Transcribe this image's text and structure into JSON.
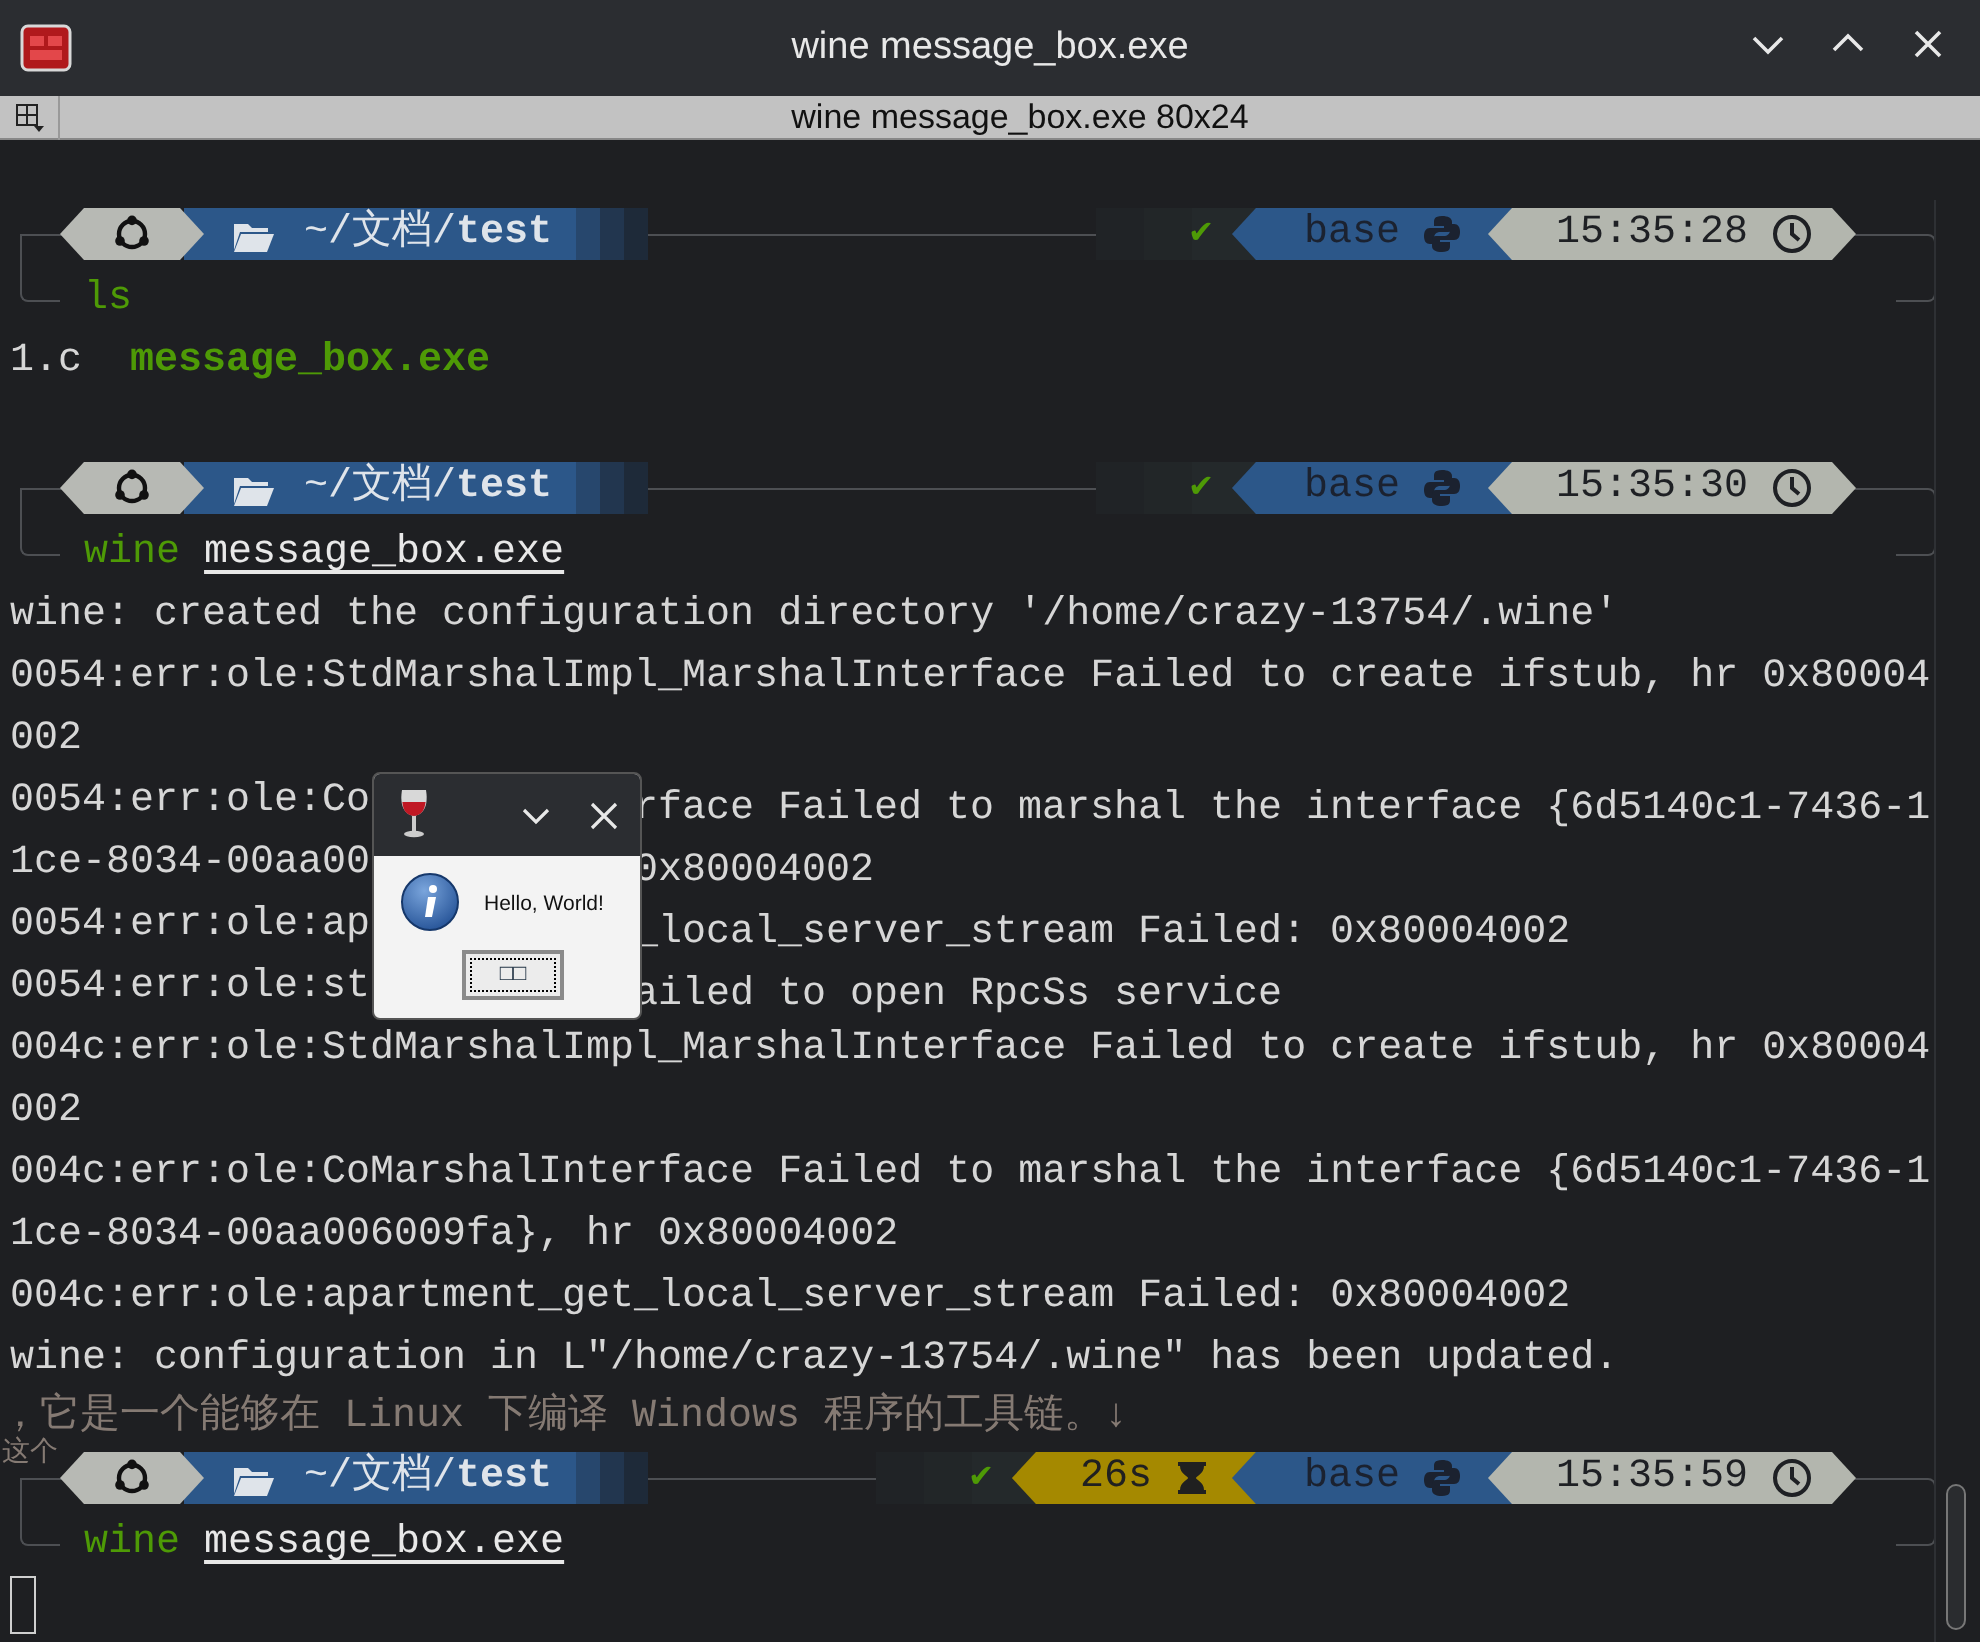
{
  "window": {
    "title": "wine message_box.exe"
  },
  "tab": {
    "title": "wine message_box.exe 80x24"
  },
  "terminal": {
    "lines": [
      {
        "kind": "prompt",
        "path": "~/文档/**test**",
        "status": "✔",
        "env": "base",
        "time": "15:35:28"
      },
      {
        "kind": "command",
        "program": "ls"
      },
      {
        "kind": "output",
        "segments": [
          {
            "text": "1.c",
            "kind": "plain"
          },
          {
            "text": "message_box.exe",
            "kind": "executable"
          }
        ]
      },
      {
        "kind": "blank"
      },
      {
        "kind": "prompt",
        "path": "~/文档/**test**",
        "status": "✔",
        "env": "base",
        "time": "15:35:30"
      },
      {
        "kind": "command",
        "program": "wine",
        "argument": "message_box.exe"
      },
      {
        "kind": "output",
        "segments": [
          {
            "text": "wine: created the configuration directory '/home/crazy-13754/.wine'",
            "kind": "plain"
          }
        ]
      },
      {
        "kind": "output",
        "segments": [
          {
            "text": "0054:err:ole:StdMarshalImpl_MarshalInterface Failed to create ifstub, hr 0x80004",
            "kind": "plain"
          }
        ]
      },
      {
        "kind": "output",
        "segments": [
          {
            "text": "002",
            "kind": "plain"
          }
        ]
      },
      {
        "kind": "output",
        "segments": [
          {
            "text": "0054:err:ole:Co",
            "kind": "plain"
          },
          {
            "text": "rface Failed to marshal the interface {6d5140c1-7436-1",
            "kind": "resumed"
          }
        ]
      },
      {
        "kind": "output",
        "segments": [
          {
            "text": "1ce-8034-00aa00",
            "kind": "plain"
          },
          {
            "text": "0x80004002",
            "kind": "resumed"
          }
        ]
      },
      {
        "kind": "output",
        "segments": [
          {
            "text": "0054:err:ole:ap",
            "kind": "plain"
          },
          {
            "text": "_local_server_stream Failed: 0x80004002",
            "kind": "resumed"
          }
        ]
      },
      {
        "kind": "output",
        "segments": [
          {
            "text": "0054:err:ole:st",
            "kind": "plain"
          },
          {
            "text": "ailed to open RpcSs service",
            "kind": "resumed"
          }
        ]
      },
      {
        "kind": "output",
        "segments": [
          {
            "text": "004c:err:ole:StdMarshalImpl_MarshalInterface Failed to create ifstub, hr 0x80004",
            "kind": "plain"
          }
        ]
      },
      {
        "kind": "output",
        "segments": [
          {
            "text": "002",
            "kind": "plain"
          }
        ]
      },
      {
        "kind": "output",
        "segments": [
          {
            "text": "004c:err:ole:CoMarshalInterface Failed to marshal the interface {6d5140c1-7436-1",
            "kind": "plain"
          }
        ]
      },
      {
        "kind": "output",
        "segments": [
          {
            "text": "1ce-8034-00aa006009fa}, hr 0x80004002",
            "kind": "plain"
          }
        ]
      },
      {
        "kind": "output",
        "segments": [
          {
            "text": "004c:err:ole:apartment_get_local_server_stream Failed: 0x80004002",
            "kind": "plain"
          }
        ]
      },
      {
        "kind": "output",
        "segments": [
          {
            "text": "wine: configuration in L\"/home/crazy-13754/.wine\" has been updated.",
            "kind": "plain"
          }
        ]
      },
      {
        "kind": "ghost",
        "text": "，它是一个能够在 Linux 下编译 Windows 程序的工具链。↓"
      },
      {
        "kind": "prompt",
        "lead": "这个",
        "path": "~/文档/**test**",
        "status": "✔",
        "duration": "26s",
        "env": "base",
        "time": "15:35:59"
      },
      {
        "kind": "command",
        "program": "wine",
        "argument": "message_box.exe"
      },
      {
        "kind": "cursor"
      }
    ]
  },
  "dialog": {
    "message": "Hello, World!",
    "button": "□□"
  }
}
